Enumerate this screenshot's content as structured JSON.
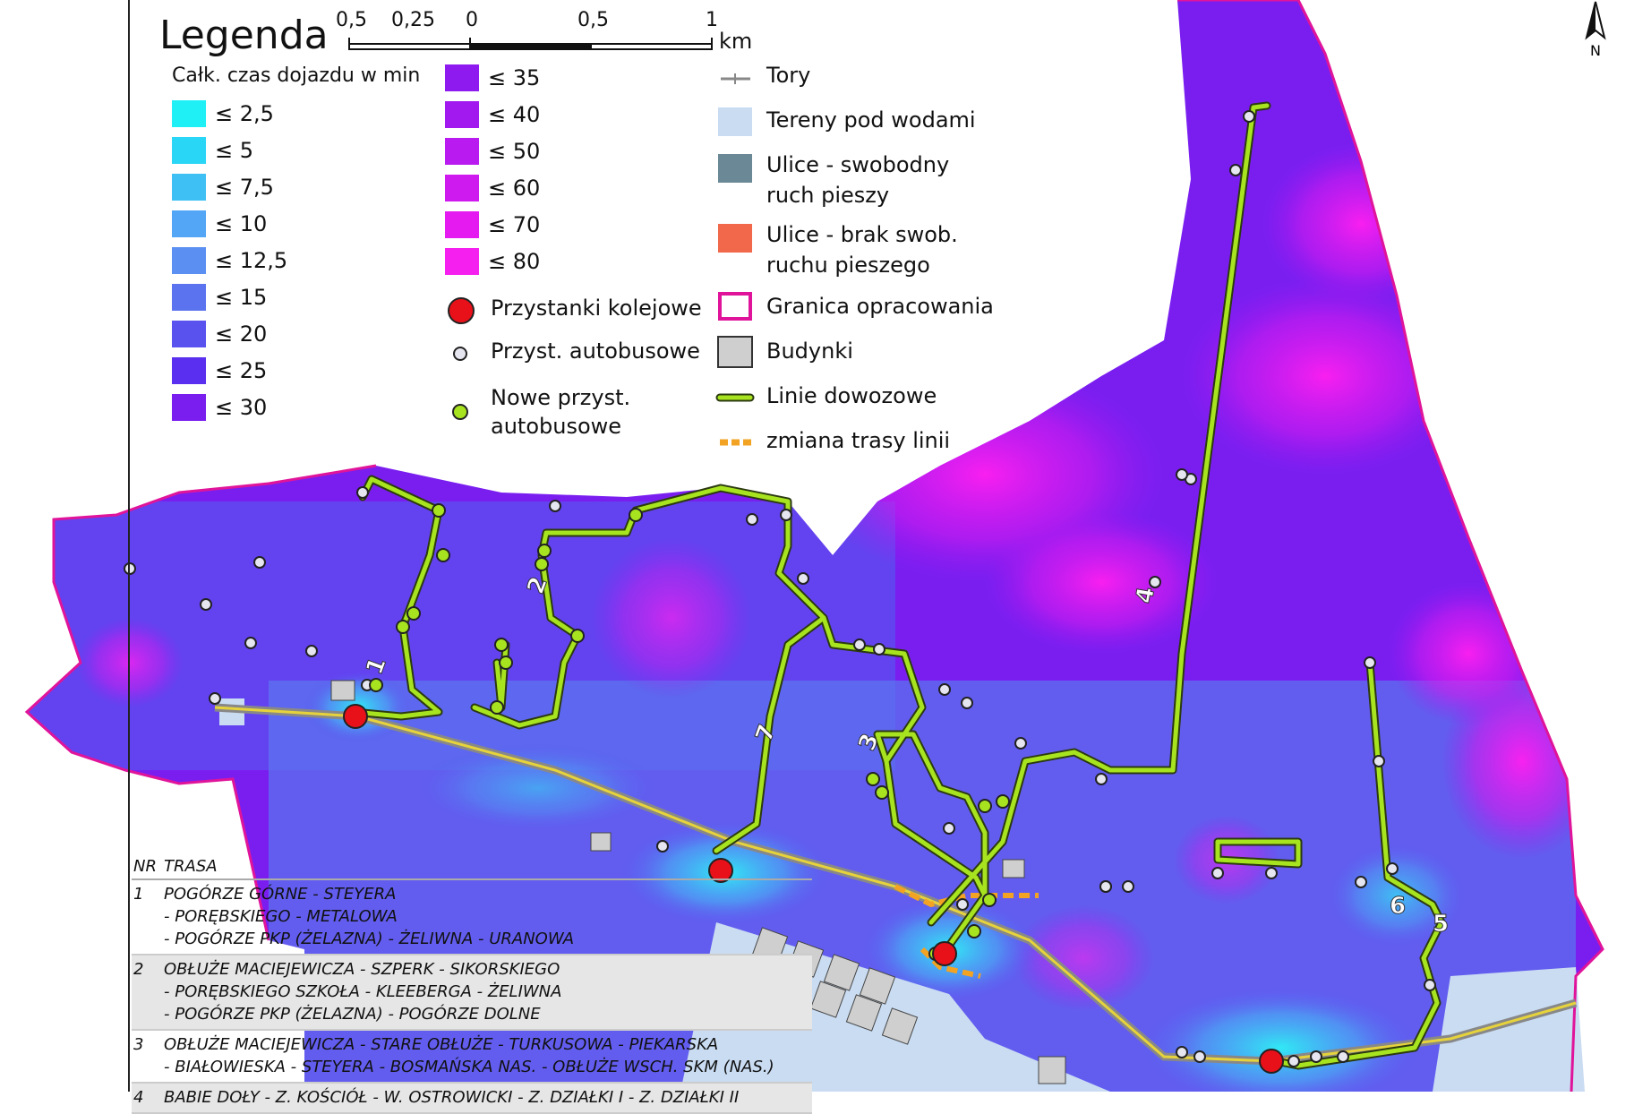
{
  "legend": {
    "title": "Legenda",
    "travel_time_header": "Całk. czas dojazdu w min",
    "travel_time_classes": [
      {
        "label": "≤ 2,5",
        "color": "#1ef0f5"
      },
      {
        "label": "≤ 5",
        "color": "#2ad6f5"
      },
      {
        "label": "≤ 7,5",
        "color": "#3fc0f5"
      },
      {
        "label": "≤ 10",
        "color": "#52a6f5"
      },
      {
        "label": "≤ 12,5",
        "color": "#5c8ff2"
      },
      {
        "label": "≤ 15",
        "color": "#5b73ef"
      },
      {
        "label": "≤ 20",
        "color": "#5a52ef"
      },
      {
        "label": "≤ 25",
        "color": "#5a2fef"
      },
      {
        "label": "≤ 30",
        "color": "#7a1ef0"
      },
      {
        "label": "≤ 35",
        "color": "#8e1af0"
      },
      {
        "label": "≤ 40",
        "color": "#a219ef"
      },
      {
        "label": "≤ 50",
        "color": "#b81aef"
      },
      {
        "label": "≤ 60",
        "color": "#cf1aef"
      },
      {
        "label": "≤ 70",
        "color": "#e51af0"
      },
      {
        "label": "≤ 80",
        "color": "#f51ff0"
      }
    ],
    "symbols": {
      "rail_stops": "Przystanki kolejowe",
      "bus_stops": "Przyst. autobusowe",
      "new_bus_stops_1": "Nowe przyst.",
      "new_bus_stops_2": "autobusowe"
    },
    "layers": {
      "rails": "Tory",
      "water": "Tereny pod wodami",
      "streets_free_1": "Ulice - swobodny",
      "streets_free_2": "ruch pieszy",
      "streets_blocked_1": "Ulice - brak swob.",
      "streets_blocked_2": "ruchu pieszego",
      "boundary": "Granica opracowania",
      "buildings": "Budynki",
      "feeder_lines": "Linie dowozowe",
      "route_change": "zmiana trasy linii"
    },
    "scale": {
      "labels": [
        "0,5",
        "0,25",
        "0",
        "0,5",
        "1"
      ],
      "unit": "km"
    },
    "north_label": "N"
  },
  "colors": {
    "rail_stop": "#e8111a",
    "bus_stop": "#e6e6f0",
    "new_stop": "#a7e41f",
    "line": "#a7e41f",
    "water": "#c9dcf2",
    "street_free": "#6b8896",
    "street_blocked": "#f2684a",
    "boundary": "#e0149a",
    "building": "#cfcfcf",
    "route_change": "#f2a323"
  },
  "routes_table": {
    "headers": [
      "NR",
      "TRASA"
    ],
    "rows": [
      {
        "nr": "1",
        "lines": [
          "POGÓRZE GÓRNE - STEYERA",
          "- PORĘBSKIEGO - METALOWA",
          "- POGÓRZE PKP (ŻELAZNA) - ŻELIWNA - URANOWA"
        ]
      },
      {
        "nr": "2",
        "lines": [
          "OBŁUŻE MACIEJEWICZA - SZPERK - SIKORSKIEGO",
          "- PORĘBSKIEGO SZKOŁA - KLEEBERGA - ŻELIWNA",
          "- POGÓRZE PKP (ŻELAZNA) - POGÓRZE DOLNE"
        ]
      },
      {
        "nr": "3",
        "lines": [
          "OBŁUŻE MACIEJEWICZA - STARE OBŁUŻE - TURKUSOWA - PIEKARSKA",
          "- BIAŁOWIESKA - STEYERA - BOSMAŃSKA NAS. - OBŁUŻE WSCH. SKM (NAS.)"
        ]
      },
      {
        "nr": "4",
        "lines": [
          "BABIE DOŁY - Z. KOŚCIÓŁ - W. OSTROWICKI - Z. DZIAŁKI I - Z. DZIAŁKI II"
        ]
      }
    ]
  },
  "map_line_labels": [
    "1",
    "2",
    "3",
    "4",
    "5",
    "6",
    "7"
  ]
}
